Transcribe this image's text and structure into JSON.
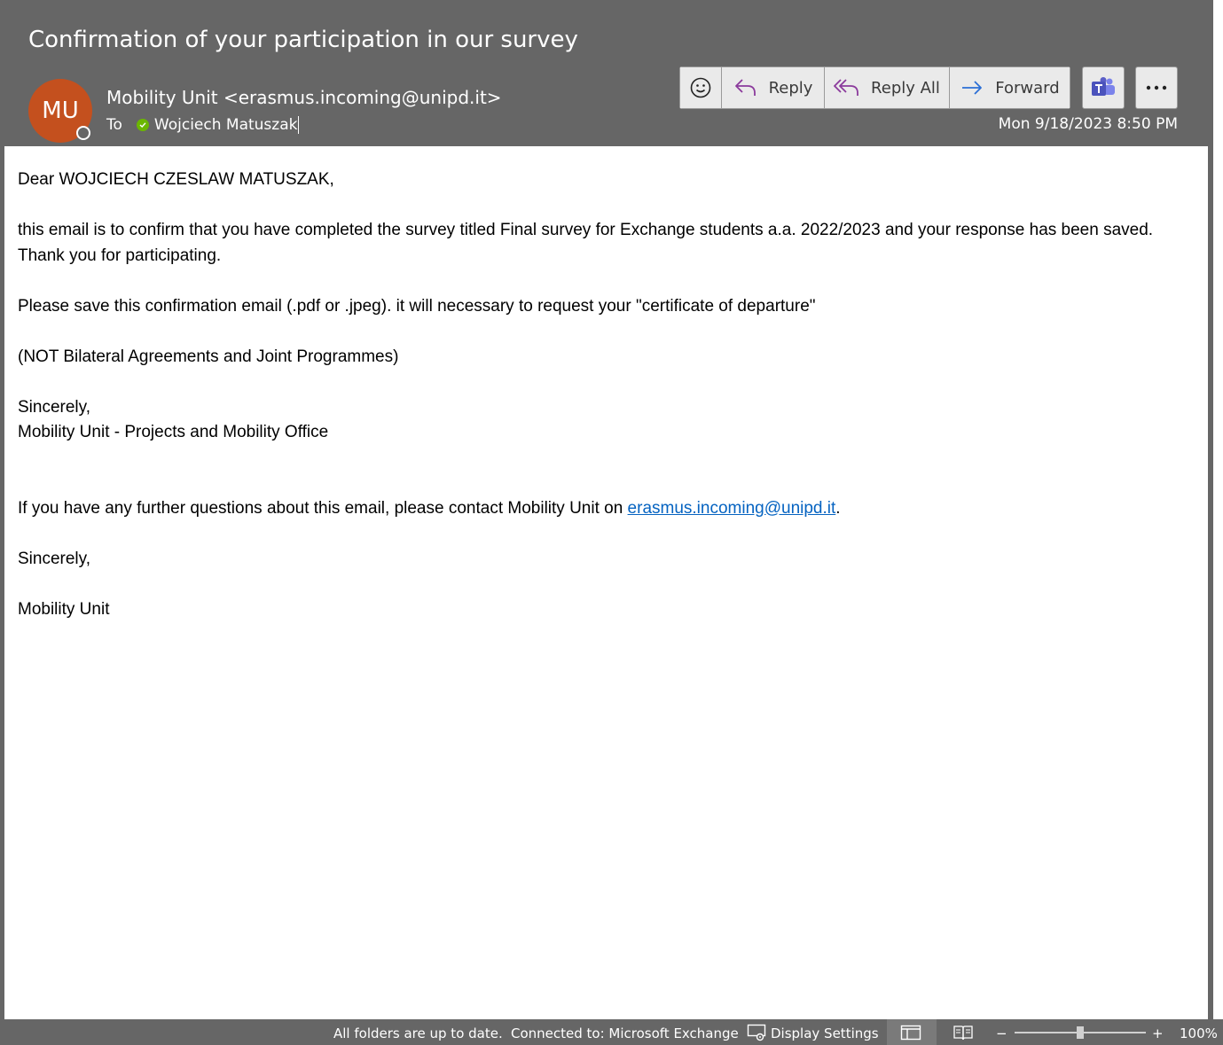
{
  "email": {
    "subject": "Confirmation of your participation in our survey",
    "avatar_initials": "MU",
    "sender": "Mobility Unit <erasmus.incoming@unipd.it>",
    "to_label": "To",
    "recipient": "Wojciech Matuszak",
    "date": "Mon 9/18/2023 8:50 PM"
  },
  "toolbar": {
    "emoji_icon": "smiley-icon",
    "reply_label": "Reply",
    "reply_all_label": "Reply All",
    "forward_label": "Forward",
    "teams_icon": "teams-icon",
    "more_icon": "ellipsis-icon"
  },
  "body": {
    "greeting": "Dear WOJCIECH CZESLAW MATUSZAK,",
    "para1": "this email is to confirm that you have completed the survey titled Final survey for Exchange students a.a. 2022/2023 and your response has been saved. Thank you for participating.",
    "para2": "Please save this confirmation email (.pdf or .jpeg). it will necessary to request your \"certificate of departure\"",
    "para3": "(NOT  Bilateral Agreements and Joint Programmes)",
    "sincerely1": "Sincerely,",
    "signature1": "Mobility Unit - Projects and Mobility Office",
    "contact_prefix": "If you have any further questions about this email, please contact Mobility Unit on ",
    "contact_email": "erasmus.incoming@unipd.it",
    "contact_suffix": ".",
    "sincerely2": "Sincerely,",
    "signature2": "Mobility Unit"
  },
  "status_bar": {
    "sync_status": "All folders are up to date.",
    "connection": "Connected to: Microsoft Exchange",
    "display_settings": "Display Settings",
    "zoom_minus": "−",
    "zoom_plus": "+",
    "zoom_level": "100%",
    "zoom_fraction": 0.5
  },
  "colors": {
    "header_bg": "#666666",
    "avatar_bg": "#c4501e",
    "link": "#0563c1",
    "reply_icon": "#8b3a9c",
    "forward_icon": "#2b6fd6",
    "teams_icon": "#5b5fc7",
    "presence_available": "#6bb700"
  }
}
